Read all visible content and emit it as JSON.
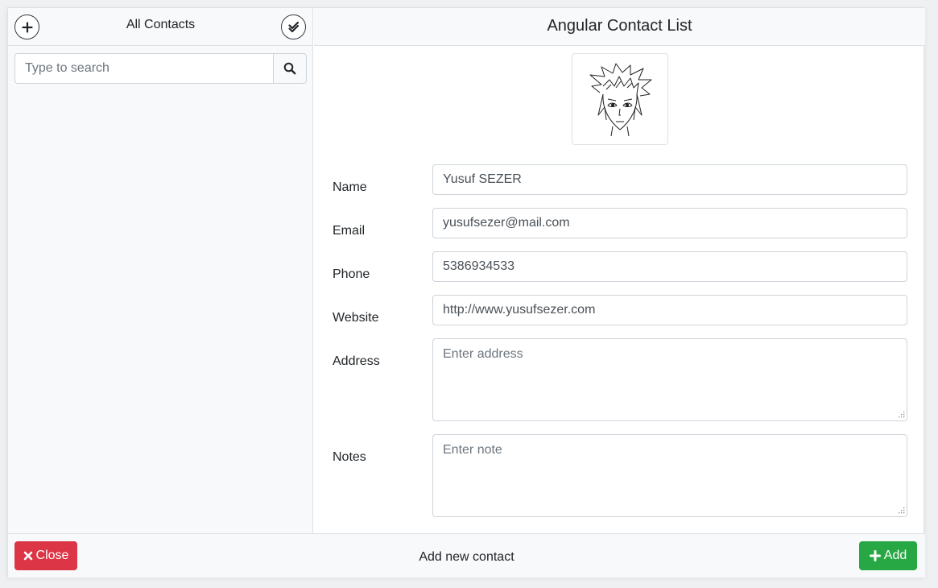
{
  "sidebar": {
    "title": "All Contacts",
    "add_icon": "plus-circle-icon",
    "select_icon": "check-double-icon",
    "search": {
      "placeholder": "Type to search",
      "value": "",
      "icon": "search-icon"
    }
  },
  "main": {
    "title": "Angular Contact List",
    "avatar_icon": "anime-avatar-image",
    "fields": {
      "name": {
        "label": "Name",
        "value": "Yusuf SEZER"
      },
      "email": {
        "label": "Email",
        "value": "yusufsezer@mail.com"
      },
      "phone": {
        "label": "Phone",
        "value": "5386934533"
      },
      "website": {
        "label": "Website",
        "value": "http://www.yusufsezer.com"
      },
      "address": {
        "label": "Address",
        "placeholder": "Enter address",
        "value": ""
      },
      "notes": {
        "label": "Notes",
        "placeholder": "Enter note",
        "value": ""
      }
    }
  },
  "footer": {
    "close_label": "Close",
    "close_icon": "times-icon",
    "status_text": "Add new contact",
    "add_label": "Add",
    "add_icon": "plus-icon"
  },
  "colors": {
    "danger": "#dc3545",
    "success": "#28a745",
    "panel_bg": "#f8f9fa",
    "border": "#dee2e6"
  }
}
